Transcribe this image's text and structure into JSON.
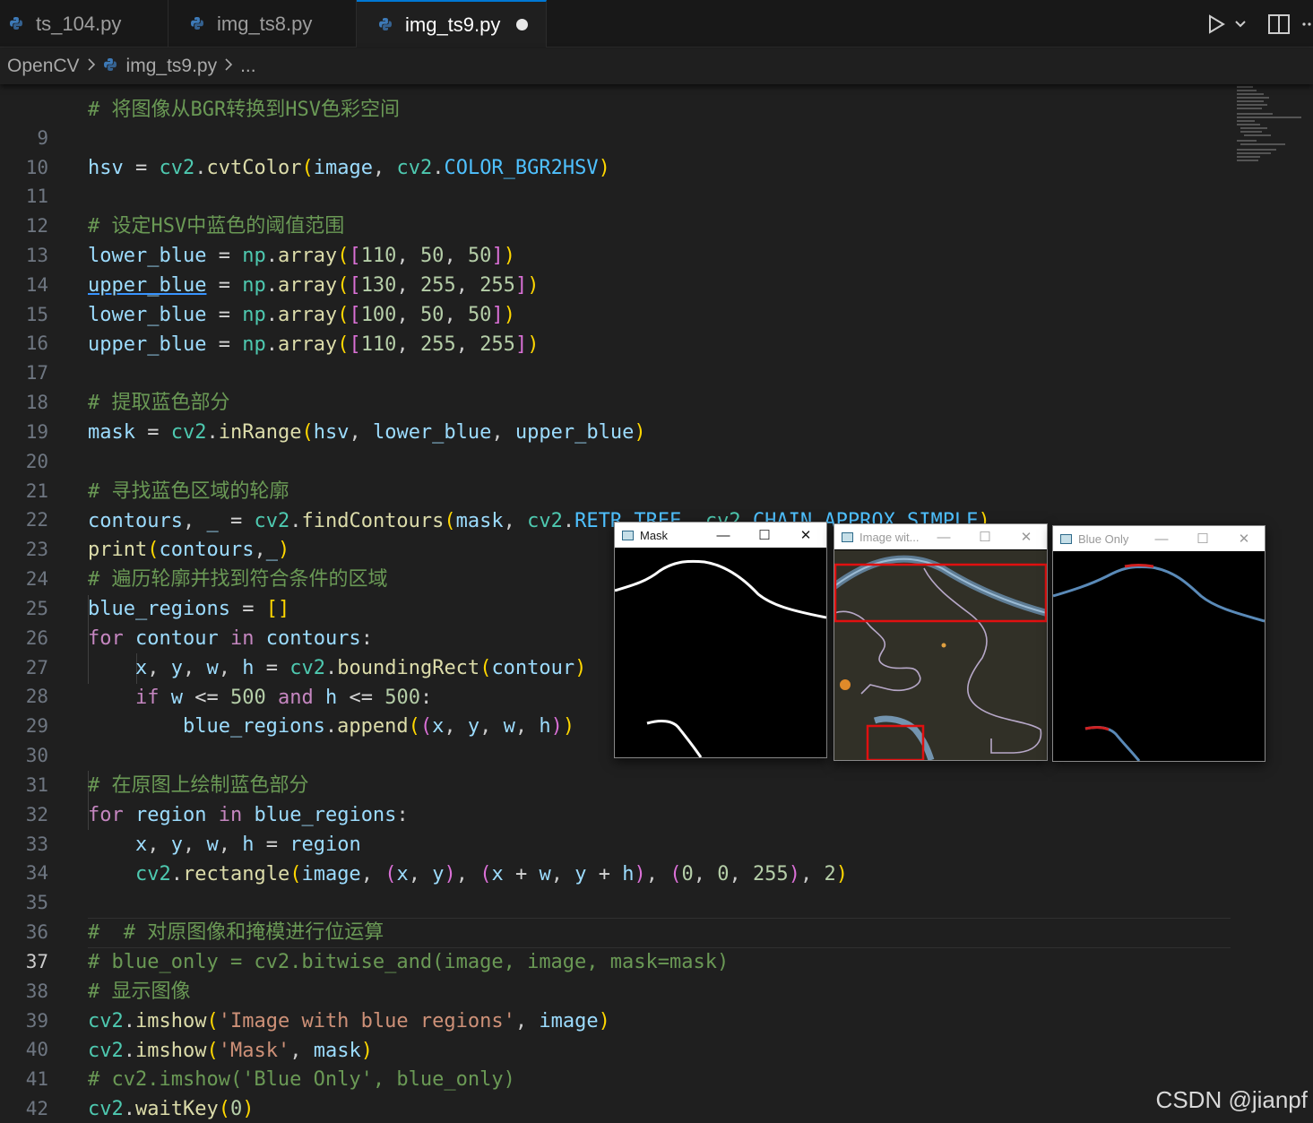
{
  "tabs": [
    {
      "label": "ts_104.py"
    },
    {
      "label": "img_ts8.py"
    },
    {
      "label": "img_ts9.py"
    }
  ],
  "breadcrumb": {
    "folder": "OpenCV",
    "file": "img_ts9.py",
    "more": "..."
  },
  "editor": {
    "partial_top": "# 将图像从BGR转换到HSV色彩空间",
    "line_numbers": [
      "9",
      "10",
      "11",
      "12",
      "13",
      "14",
      "15",
      "16",
      "17",
      "18",
      "19",
      "20",
      "21",
      "22",
      "23",
      "24",
      "25",
      "26",
      "27",
      "28",
      "29",
      "30",
      "31",
      "32",
      "33",
      "34",
      "35",
      "36",
      "37",
      "38",
      "39",
      "40",
      "41",
      "42"
    ],
    "comments": {
      "l11": "# 设定HSV中蓝色的阈值范围",
      "l17": "# 提取蓝色部分",
      "l20": "# 寻找蓝色区域的轮廓",
      "l23": "# 遍历轮廓并找到符合条件的区域",
      "l30": "# 在原图上绘制蓝色部分",
      "l35": "#  # 对原图像和掩模进行位运算",
      "l36": "# blue_only = cv2.bitwise_and(image, image, mask=mask)",
      "l37": "# 显示图像",
      "l40": "# cv2.imshow('Blue Only', blue_only)"
    },
    "strings": {
      "l38": "'Image with blue regions'",
      "l39": "'Mask'"
    }
  },
  "windows": {
    "mask": {
      "title": "Mask"
    },
    "image": {
      "title": "Image wit..."
    },
    "blue_only": {
      "title": "Blue Only"
    },
    "controls": {
      "minimize": "—",
      "maximize": "☐",
      "close": "✕"
    }
  },
  "watermark": "CSDN @jianpf",
  "colors": {
    "accent": "#0078d4",
    "rect_red": "#e01010",
    "contour_blue": "#5a8ab8"
  },
  "icons": [
    "python-file-icon",
    "run-icon",
    "chevron-down-icon",
    "split-editor-icon",
    "more-icon",
    "window-app-icon"
  ]
}
